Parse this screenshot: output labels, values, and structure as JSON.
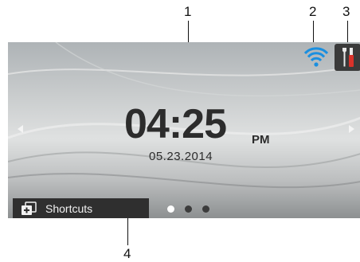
{
  "callouts": [
    "1",
    "2",
    "3",
    "4"
  ],
  "clock": {
    "time": "04:25",
    "ampm": "PM",
    "date": "05.23.2014"
  },
  "shortcuts": {
    "label": "Shortcuts"
  },
  "page_indicator": {
    "total": 3,
    "active": 1
  },
  "icons": {
    "wifi": "wifi-signal-icon",
    "tools": "tools-settings-icon",
    "shortcuts": "shortcuts-icon",
    "left": "left-arrow-icon",
    "right": "right-arrow-icon"
  },
  "colors": {
    "wifi": "#1a8fe0",
    "screwdriver": "#d9322a",
    "dot_active": "#ffffff",
    "dot_inactive": "#3c3c3c"
  }
}
